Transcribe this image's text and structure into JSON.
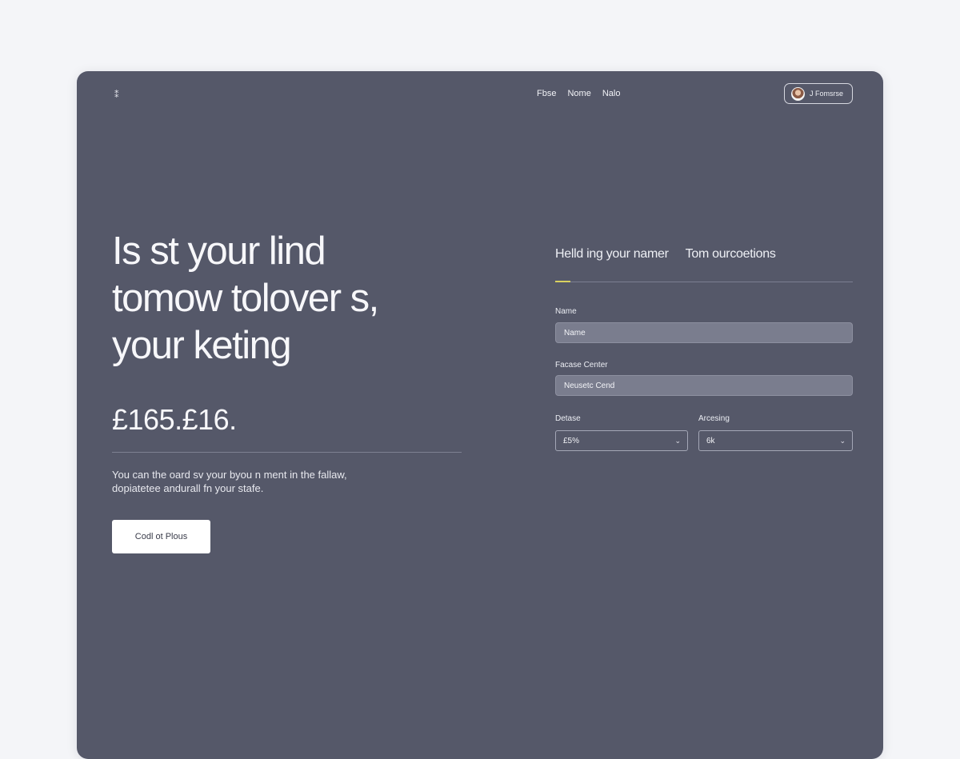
{
  "header": {
    "logo": "⁑",
    "nav": [
      "Fbse",
      "Nome",
      "Nalo"
    ],
    "account_label": "J Fomsrse"
  },
  "hero": {
    "headline_lines": [
      "Is st your lind",
      "tomow tolover s,",
      "your keting"
    ],
    "price": "£165.£16.",
    "description_lines": [
      "You can the oard sv your byou n ment in the fallaw,",
      "dopiatetee andurall fn your stafe."
    ],
    "cta_label": "Codl ot Plous"
  },
  "form": {
    "tabs": [
      "Helld ing your namer",
      "Tom ourcoetions"
    ],
    "name_label": "Name",
    "name_value": "Name",
    "center_label": "Facase Center",
    "center_value": "Neusetc Cend",
    "detase_label": "Detase",
    "detase_value": "£5%",
    "arcesing_label": "Arcesing",
    "arcesing_value": "6k"
  },
  "colors": {
    "background": "#f4f5f8",
    "card": "#555869",
    "accent": "#d9d160"
  }
}
